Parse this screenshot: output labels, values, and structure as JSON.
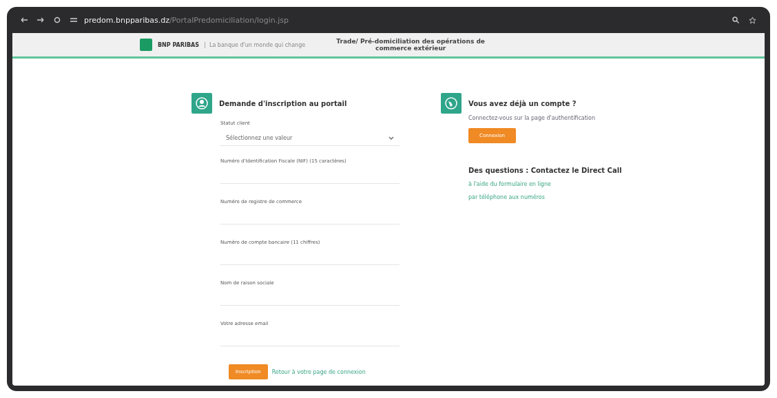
{
  "browser": {
    "url_host": "predom.bnpparibas.dz",
    "url_path": "/PortalPredomiciliation/login.jsp"
  },
  "header": {
    "brand": "BNP PARIBAS",
    "tagline": "La banque d'un monde qui change",
    "title": "Trade/ Pré-domiciliation des opérations de commerce extérieur"
  },
  "register": {
    "title": "Demande d'inscription au portail",
    "fields": [
      {
        "kind": "select",
        "label": "Statut client",
        "value": "Sélectionnez une valeur"
      },
      {
        "kind": "text",
        "label": "Numéro d'Identification Fiscale (NIF) (15 caractères)"
      },
      {
        "kind": "text",
        "label": "Numéro de registre de commerce"
      },
      {
        "kind": "text",
        "label": "Numéro de compte bancaire (11 chiffres)"
      },
      {
        "kind": "text",
        "label": "Nom de raison sociale"
      },
      {
        "kind": "text",
        "label": "Votre adresse email"
      }
    ],
    "submit": "Inscription",
    "back_link": "Retour à votre page de connexion"
  },
  "login": {
    "title": "Vous avez déjà un compte ?",
    "text": "Connectez-vous sur la page d'authentification",
    "button": "Connexion"
  },
  "contact": {
    "title": "Des questions : Contactez le Direct Call",
    "links": [
      "à l'aide du formulaire en ligne",
      "par téléphone aux numéros"
    ]
  }
}
